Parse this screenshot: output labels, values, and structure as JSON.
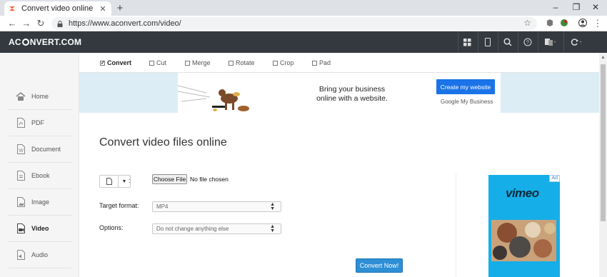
{
  "browser": {
    "tab_title": "Convert video online",
    "close_glyph": "✕",
    "newtab_glyph": "+",
    "url": "https://www.aconvert.com/video/",
    "window_controls": {
      "minimize": "–",
      "restore": "❐",
      "close": "✕"
    },
    "nav": {
      "back": "←",
      "forward": "→",
      "reload": "↻"
    },
    "star": "☆",
    "menu": "⋮"
  },
  "site": {
    "logo_prefix": "AC",
    "logo_suffix": "NVERT.COM"
  },
  "sidebar": {
    "items": [
      {
        "label": "Home",
        "icon": "home-icon"
      },
      {
        "label": "PDF",
        "icon": "pdf-file-icon"
      },
      {
        "label": "Document",
        "icon": "document-icon"
      },
      {
        "label": "Ebook",
        "icon": "ebook-icon"
      },
      {
        "label": "Image",
        "icon": "image-icon"
      },
      {
        "label": "Video",
        "icon": "video-icon"
      },
      {
        "label": "Audio",
        "icon": "audio-icon"
      }
    ],
    "active": "Video"
  },
  "tools": {
    "items": [
      "Convert",
      "Cut",
      "Merge",
      "Rotate",
      "Crop",
      "Pad"
    ],
    "active": "Convert",
    "check_glyph": "✓"
  },
  "ad_banner": {
    "headline_line1": "Bring your business",
    "headline_line2": "online with a website.",
    "cta": "Create my website",
    "brand": "Google My Business"
  },
  "main": {
    "heading": "Convert video files online",
    "file": {
      "colon": ":",
      "choose_label": "Choose File",
      "status": "No file chosen",
      "dropdown_glyph": "▼"
    },
    "target_format": {
      "label": "Target format:",
      "value": "MP4"
    },
    "options": {
      "label": "Options:",
      "value": "Do not change anything else"
    },
    "convert_button": "Convert Now!"
  },
  "side_ad": {
    "tag": "Ad",
    "brand": "vimeo"
  },
  "colors": {
    "header_bg": "#33393f",
    "accent_blue": "#2d8fd5",
    "ad_cta": "#1a73e8",
    "vimeo_bg": "#15aee8"
  }
}
